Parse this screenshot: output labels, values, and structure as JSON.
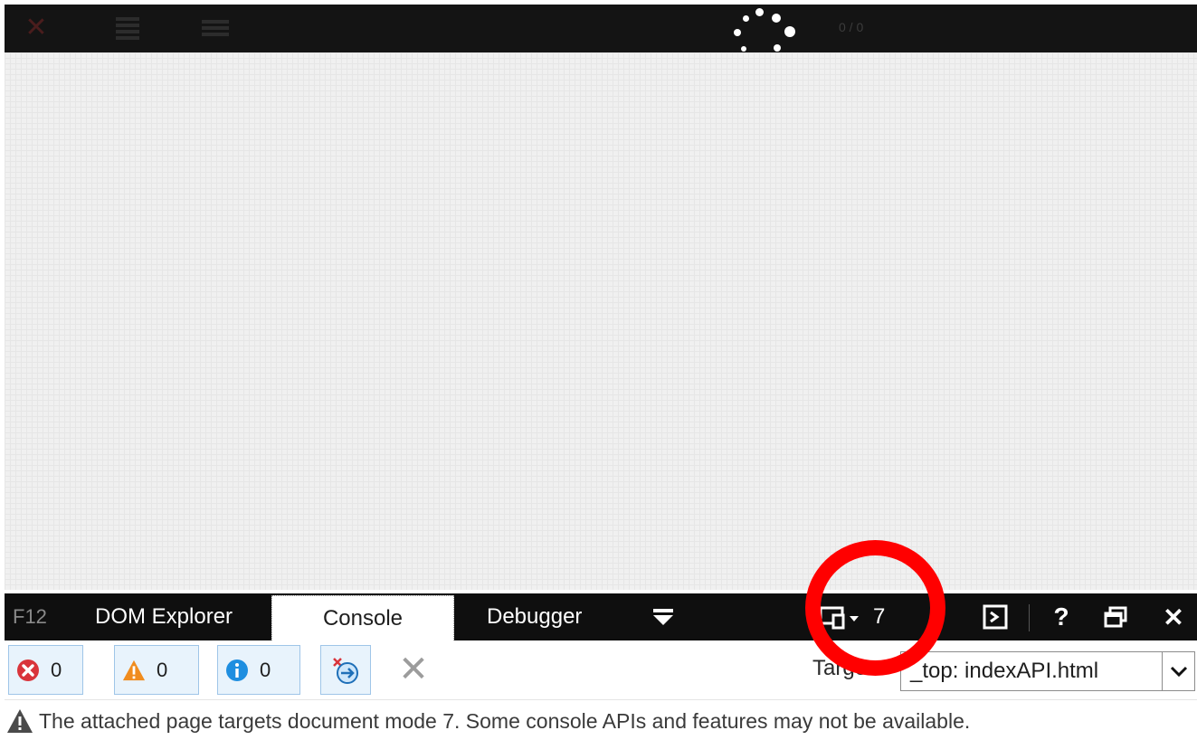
{
  "app_bar": {
    "progress_count": "0 / 0"
  },
  "devtools": {
    "key_label": "F12",
    "tabs": [
      {
        "label": "DOM Explorer"
      },
      {
        "label": "Console"
      },
      {
        "label": "Debugger"
      }
    ],
    "active_tab": "Console",
    "emulation": {
      "document_mode": "7",
      "icon": "browser-emulation-icon"
    },
    "buttons": {
      "help": "?",
      "close": "✕"
    }
  },
  "console_toolbar": {
    "errors_count": "0",
    "warnings_count": "0",
    "messages_count": "0",
    "target_label": "Target:",
    "target_value": "_top: indexAPI.html"
  },
  "notice": {
    "text": "The attached page targets document mode 7. Some console APIs and features may not be available."
  },
  "colors": {
    "bar_background": "#0f0f0f",
    "error": "#d9343b",
    "warning": "#f08c1e",
    "info": "#1e8ee0",
    "annotation": "#ff0000"
  }
}
